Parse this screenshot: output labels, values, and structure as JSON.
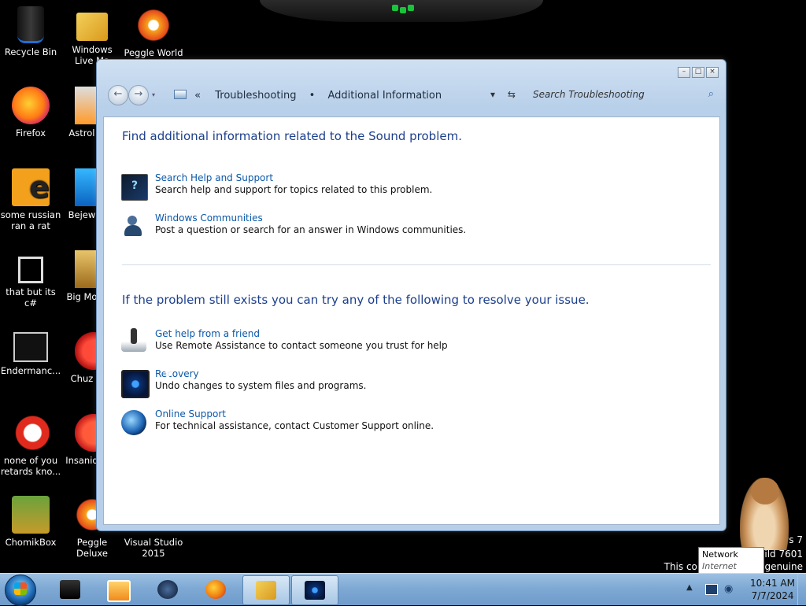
{
  "desktop": {
    "icons": [
      {
        "label": "Recycle Bin",
        "icon": "recycle-bin-icon"
      },
      {
        "label": "Windows Live Ma",
        "icon": "windows-live-icon"
      },
      {
        "label": "Peggle World",
        "icon": "peggle-icon"
      },
      {
        "label": "Firefox",
        "icon": "firefox-icon"
      },
      {
        "label": "Astrol Delu",
        "icon": "astro-icon"
      },
      {
        "label": "some russian ran a rat",
        "icon": "e-app-icon"
      },
      {
        "label": "Bejew Delu",
        "icon": "bejeweled-icon"
      },
      {
        "label": "that but its c#",
        "icon": "shortcut-stack-icon"
      },
      {
        "label": "Big Mo Delu",
        "icon": "big-money-icon"
      },
      {
        "label": "Endermanc...",
        "icon": "app-window-icon"
      },
      {
        "label": "Chuz Delu",
        "icon": "chuzzle-icon"
      },
      {
        "label": "none of you retards kno...",
        "icon": "red-bird-icon"
      },
      {
        "label": "Insaniq Delu",
        "icon": "insaniquarium-icon"
      },
      {
        "label": "ChomikBox",
        "icon": "chomikbox-icon"
      },
      {
        "label": "Peggle Deluxe",
        "icon": "peggle-icon"
      },
      {
        "label": "Visual Studio 2015",
        "icon": "visual-studio-icon"
      }
    ]
  },
  "window": {
    "breadcrumbs": [
      "Troubleshooting",
      "Additional Information"
    ],
    "breadcrumb_chevron": "«",
    "separator": "•",
    "search_placeholder": "Search Troubleshooting",
    "section1_title": "Find additional information related to the Sound problem.",
    "section1_items": [
      {
        "link": "Search Help and Support",
        "desc": "Search help and support for topics related to this problem.",
        "icon": "help-support-icon"
      },
      {
        "link": "Windows Communities",
        "desc": "Post a question or search for an answer in Windows communities.",
        "icon": "communities-icon"
      }
    ],
    "section2_title": "If the problem still exists you can try any of the following to resolve your issue.",
    "section2_items": [
      {
        "link": "Get help from a friend",
        "desc": "Use Remote Assistance to contact someone you trust for help",
        "icon": "remote-assistance-icon"
      },
      {
        "link": "Recovery",
        "desc": "Undo changes to system files and programs.",
        "icon": "recovery-icon"
      },
      {
        "link": "Online Support",
        "desc": "For technical assistance, contact Customer Support online.",
        "icon": "online-support-icon"
      }
    ]
  },
  "watermark": {
    "line1": "ws 7",
    "line2": "ild 7601",
    "line3": "This copy of",
    "line3b": "genuine"
  },
  "tooltip": {
    "title": "Network",
    "sub": "Internet access"
  },
  "taskbar": {
    "time": "10:41 AM",
    "date": "7/7/2024"
  }
}
